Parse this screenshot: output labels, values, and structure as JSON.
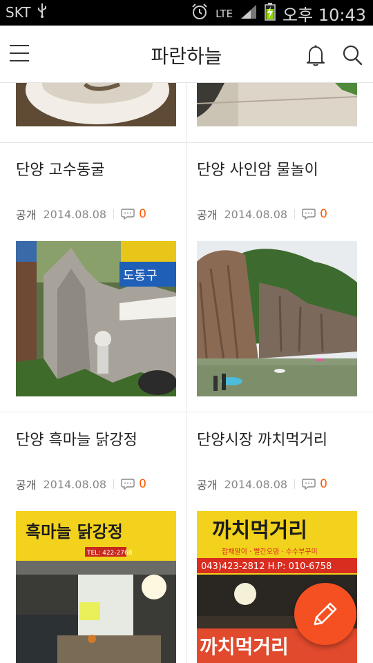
{
  "status_bar": {
    "carrier": "SKT",
    "network": "LTE",
    "time": "오후 10:43"
  },
  "app_bar": {
    "title": "파란하늘",
    "icons": [
      "menu-icon",
      "bell-icon",
      "search-icon"
    ]
  },
  "posts": [
    {
      "title": "단양 고수동굴",
      "visibility": "공개",
      "date": "2014.08.08",
      "comments": "0"
    },
    {
      "title": "단양 사인암 물놀이",
      "visibility": "공개",
      "date": "2014.08.08",
      "comments": "0"
    },
    {
      "title": "단양 흑마늘 닭강정",
      "visibility": "공개",
      "date": "2014.08.08",
      "comments": "0"
    },
    {
      "title": "단양시장 까치먹거리",
      "visibility": "공개",
      "date": "2014.08.08",
      "comments": "0"
    }
  ],
  "signs": {
    "sign_a": "도동구",
    "sign_b": "흑마늘 닭강정",
    "sign_b_phone": "TEL: 422-2768",
    "sign_c": "까치먹거리",
    "sign_c_sub": "잡채말이 · 빨간오뎅 · 수수부꾸미",
    "sign_c_phone": "043)423-2812  H.P: 010-6758",
    "sign_d": "까치먹거리"
  },
  "colors": {
    "accent": "#ff5a00",
    "fab": "#f55022"
  }
}
